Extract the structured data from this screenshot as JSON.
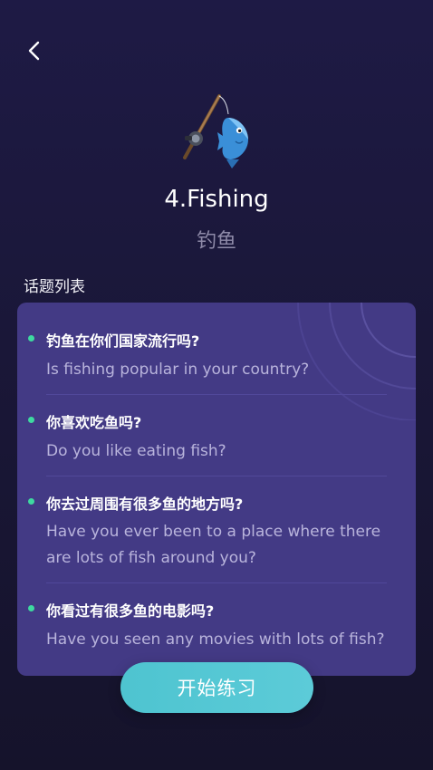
{
  "header": {
    "back_icon": "chevron-left-icon"
  },
  "topic": {
    "icon": "fishing-rod-and-fish-icon",
    "title": "4.Fishing",
    "subtitle": "钓鱼"
  },
  "list": {
    "label": "话题列表",
    "items": [
      {
        "zh": "钓鱼在你们国家流行吗?",
        "en": "Is fishing popular in your country?"
      },
      {
        "zh": "你喜欢吃鱼吗?",
        "en": "Do you like eating fish?"
      },
      {
        "zh": "你去过周围有很多鱼的地方吗?",
        "en": "Have you ever been to a place where there are lots of fish around you?"
      },
      {
        "zh": "你看过有很多鱼的电影吗?",
        "en": "Have you seen any movies with lots of fish?"
      }
    ]
  },
  "actions": {
    "start_label": "开始练习"
  },
  "colors": {
    "background": "#1c1940",
    "card": "#433a85",
    "bullet": "#3ed9a0",
    "button": "#55c8d4"
  }
}
